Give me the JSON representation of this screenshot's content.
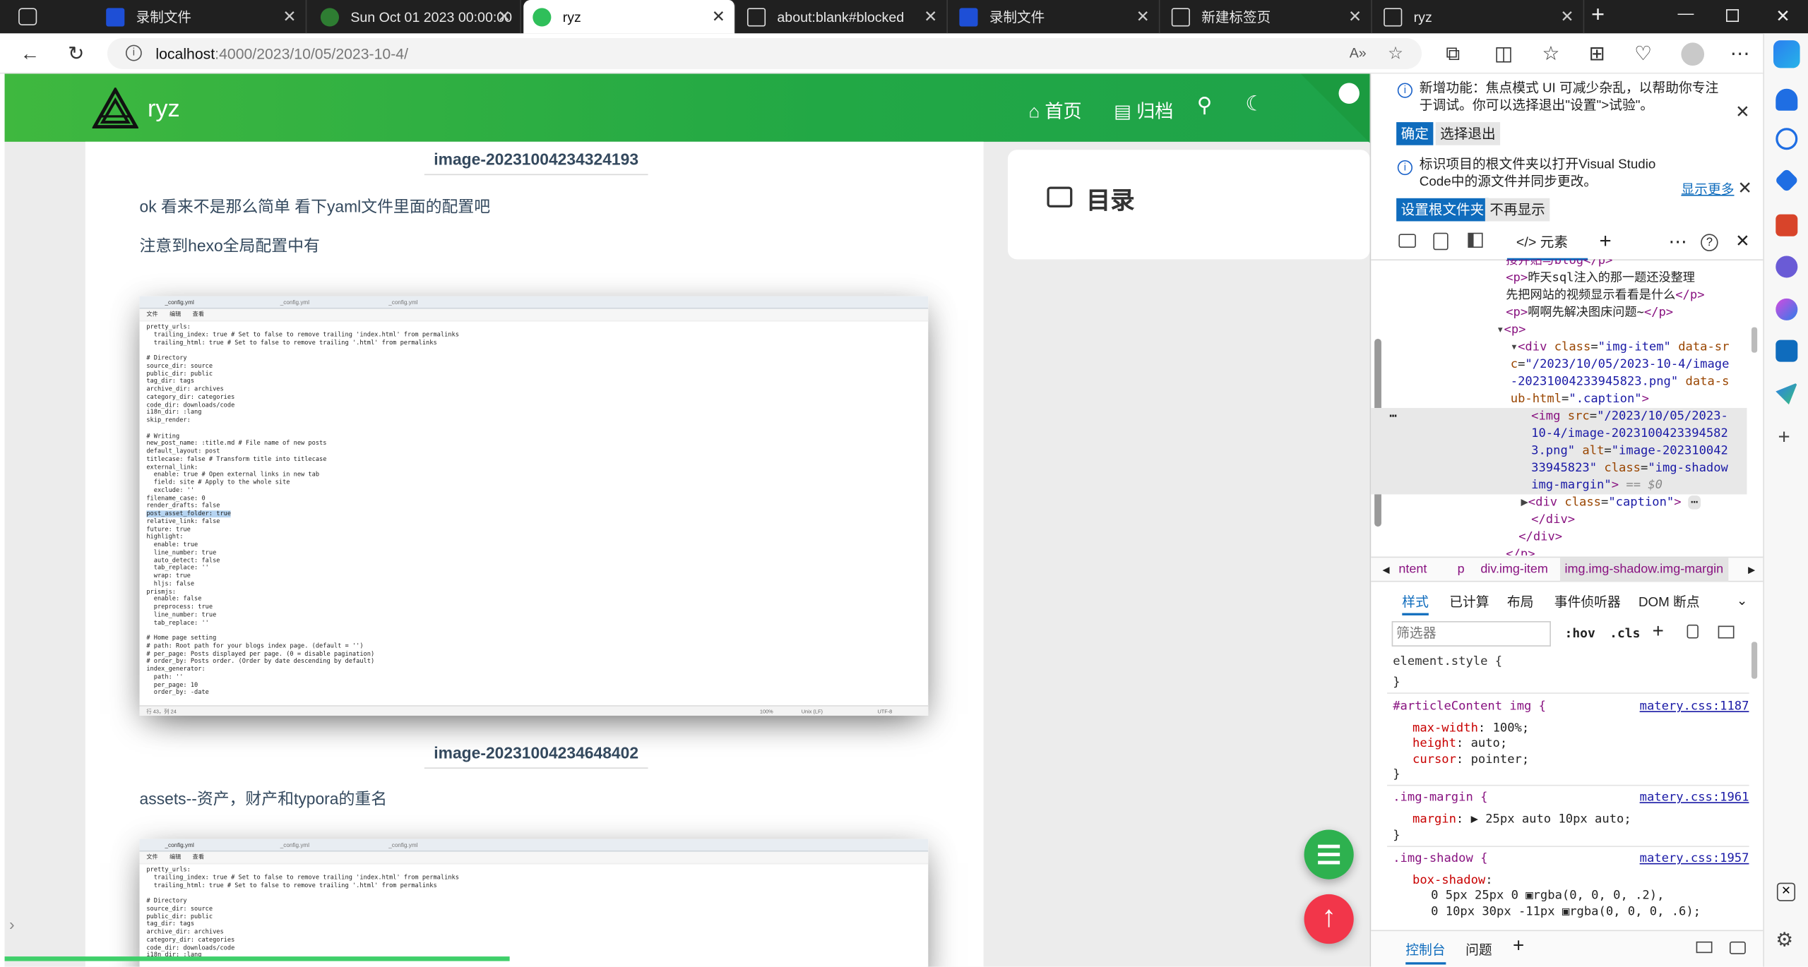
{
  "tabs": [
    {
      "title": "录制文件",
      "icon": "recording-icon"
    },
    {
      "title": "Sun Oct 01 2023 00:00:00",
      "icon": "hexo-leaf-icon"
    },
    {
      "title": "ryz",
      "icon": "hexo-leaf-icon",
      "active": true
    },
    {
      "title": "about:blank#blocked",
      "icon": "page-icon"
    },
    {
      "title": "录制文件",
      "icon": "recording-icon"
    },
    {
      "title": "新建标签页",
      "icon": "newtab-icon"
    },
    {
      "title": "ryz",
      "icon": "page-icon"
    }
  ],
  "address": {
    "host": "localhost",
    "path": ":4000/2023/10/05/2023-10-4/"
  },
  "site": {
    "name": "ryz",
    "menu_home": "首页",
    "menu_archive": "归档",
    "toc_title": "目录"
  },
  "article": {
    "caption1": "image-20231004234324193",
    "para1": "ok 看来不是那么简单 看下yaml文件里面的配置吧",
    "para2": "注意到hexo全局配置中有",
    "caption2": "image-20231004234648402",
    "para3": "assets--资产，财产和typora的重名",
    "shot_tab1": "_config.yml",
    "shot_tab2": "_config.yml",
    "shot_tab3": "_config.yml",
    "shot_menu": "文件　　编辑　　查看",
    "shot_code1": "pretty_urls:\n  trailing_index: true # Set to false to remove trailing 'index.html' from permalinks\n  trailing_html: true # Set to false to remove trailing '.html' from permalinks\n\n# Directory\nsource_dir: source\npublic_dir: public\ntag_dir: tags\narchive_dir: archives\ncategory_dir: categories\ncode_dir: downloads/code\ni18n_dir: :lang\nskip_render:\n\n# Writing\nnew_post_name: :title.md # File name of new posts\ndefault_layout: post\ntitlecase: false # Transform title into titlecase\nexternal_link:\n  enable: true # Open external links in new tab\n  field: site # Apply to the whole site\n  exclude: ''\nfilename_case: 0\nrender_drafts: false",
    "shot_highlight": "post_asset_folder: true",
    "shot_code2": "relative_link: false\nfuture: true\nhighlight:\n  enable: true\n  line_number: true\n  auto_detect: false\n  tab_replace: ''\n  wrap: true\n  hljs: false\nprismjs:\n  enable: false\n  preprocess: true\n  line_number: true\n  tab_replace: ''\n\n# Home page setting\n# path: Root path for your blogs index page. (default = '')\n# per_page: Posts displayed per page. (0 = disable pagination)\n# order_by: Posts order. (Order by date descending by default)\nindex_generator:\n  path: ''\n  per_page: 10\n  order_by: -date",
    "shot_status": "行 43，列 24",
    "shot_zoom": "100%",
    "shot_eol": "Unix (LF)",
    "shot_enc": "UTF-8",
    "shot2_code": "pretty_urls:\n  trailing_index: true # Set to false to remove trailing 'index.html' from permalinks\n  trailing_html: true # Set to false to remove trailing '.html' from permalinks\n\n# Directory\nsource_dir: source\npublic_dir: public\ntag_dir: tags\narchive_dir: archives\ncategory_dir: categories\ncode_dir: downloads/code\ni18n_dir: :lang"
  },
  "devtools": {
    "notice1": "新增功能：焦点模式 UI 可减少杂乱，以帮助你专注于调试。你可以选择退出\"设置\">试验\"。",
    "notice1_ok": "确定",
    "notice1_optout": "选择退出",
    "notice2": "标识项目的根文件夹以打开Visual Studio Code中的源文件并同步更改。",
    "notice2_more": "显示更多",
    "notice2_set": "设置根文件夹",
    "notice2_dismiss": "不再显示",
    "elements_tab": "元素",
    "dom": {
      "l0": "接并贴与blog</p>",
      "l1a": "<p>",
      "l1b": "昨天sql注入的那一题还没整理 先把网站的视频显示看看是什么",
      "l1c": "</p>",
      "l2a": "<p>",
      "l2b": "啊啊先解决图床问题~",
      "l2c": "</p>",
      "l3": "<p>",
      "l4_tag": "<div ",
      "l4_attr1": "class",
      "l4_val1": "\"img-item\"",
      "l4_attr2": "data-src",
      "l4_val2": "\"/2023/10/05/2023-10-4/image-20231004233945823.png\"",
      "l4_attr3": "data-sub-html",
      "l4_val3": "\".caption\"",
      "l5_tag": "<img ",
      "l5_attr1": "src",
      "l5_val1": "\"/2023/10/05/2023-10-4/image-20231004233945823.png\"",
      "l5_attr2": "alt",
      "l5_val2": "\"image-20231004233945823\"",
      "l5_attr3": "class",
      "l5_val3": "\"img-shadow img-margin\"",
      "l5_eq": "== $0",
      "l6_tag": "<div ",
      "l6_attr": "class",
      "l6_val": "\"caption\"",
      "l7": "</div>",
      "l8": "</div>",
      "l9": "</p>"
    },
    "breadcrumb": [
      "ntent",
      "p",
      "div.img-item",
      "img.img-shadow.img-margin"
    ],
    "style_tabs": [
      "样式",
      "已计算",
      "布局",
      "事件侦听器",
      "DOM 断点"
    ],
    "filter_placeholder": "筛选器",
    "hov": ":hov",
    "cls": ".cls",
    "rules": [
      {
        "selector": "element.style {",
        "source": ""
      },
      {
        "selector": "#articleContent img {",
        "source": "matery.css:1187",
        "props": [
          [
            "max-width",
            "100%;"
          ],
          [
            "height",
            "auto;"
          ],
          [
            "cursor",
            "pointer;"
          ]
        ]
      },
      {
        "selector": ".img-margin {",
        "source": "matery.css:1961",
        "props": [
          [
            "margin",
            "▶ 25px auto 10px auto;"
          ]
        ]
      },
      {
        "selector": ".img-shadow {",
        "source": "matery.css:1957",
        "props": [
          [
            "box-shadow",
            ""
          ]
        ]
      }
    ],
    "shadow1": "0 5px 25px 0 ▣rgba(0, 0, 0, .2),",
    "shadow2": "0 10px 30px -11px ▣rgba(0, 0, 0, .6);",
    "close_brace": "}",
    "bottom_console": "控制台",
    "bottom_issues": "问题"
  }
}
